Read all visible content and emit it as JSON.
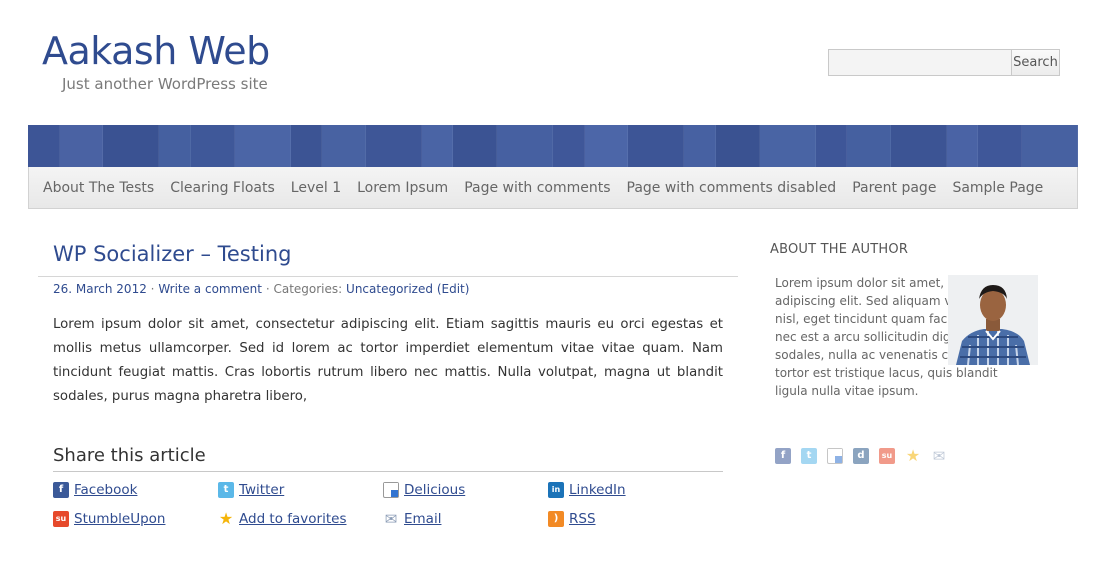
{
  "site": {
    "title": "Aakash Web",
    "tagline": "Just another WordPress site"
  },
  "search": {
    "placeholder": "",
    "button_label": "Search"
  },
  "nav": {
    "items": [
      {
        "label": "About The Tests"
      },
      {
        "label": "Clearing Floats"
      },
      {
        "label": "Level 1"
      },
      {
        "label": "Lorem Ipsum"
      },
      {
        "label": "Page with comments"
      },
      {
        "label": "Page with comments disabled"
      },
      {
        "label": "Parent page"
      },
      {
        "label": "Sample Page"
      }
    ]
  },
  "post": {
    "title": "WP Socializer – Testing",
    "date": "26. March 2012",
    "comment_link": "Write a comment",
    "categories_label": "Categories:",
    "category": "Uncategorized",
    "edit_link": "(Edit)",
    "body": "Lorem ipsum dolor sit amet, consectetur adipiscing elit. Etiam sagittis mauris eu orci egestas et mollis metus ullamcorper. Sed id lorem ac tortor imperdiet elementum vitae vitae quam. Nam tincidunt feugiat mattis. Cras lobortis rutrum libero nec mattis. Nulla volutpat, magna ut blandit sodales, purus magna pharetra libero,"
  },
  "share": {
    "heading": "Share this article",
    "items": [
      {
        "label": "Facebook",
        "icon": "facebook-icon",
        "color": "#3b5998"
      },
      {
        "label": "Twitter",
        "icon": "twitter-icon",
        "color": "#5bb8e8"
      },
      {
        "label": "Delicious",
        "icon": "delicious-icon",
        "color": "#222222"
      },
      {
        "label": "LinkedIn",
        "icon": "linkedin-icon",
        "color": "#1b73b8"
      },
      {
        "label": "StumbleUpon",
        "icon": "stumbleupon-icon",
        "color": "#e6492b"
      },
      {
        "label": "Add to favorites",
        "icon": "star-icon",
        "color": "#f5b50a"
      },
      {
        "label": "Email",
        "icon": "email-icon",
        "color": "#8a9bb5"
      },
      {
        "label": "RSS",
        "icon": "rss-icon",
        "color": "#f28a25"
      }
    ]
  },
  "sidebar": {
    "heading": "ABOUT THE AUTHOR",
    "author_text": "Lorem ipsum dolor sit amet, consectetur adipiscing elit. Sed aliquam venenatis nisl, eget tincidunt quam facilisis in. Sed nec est a arcu sollicitudin dignissim. Nulla sodales, nulla ac venenatis convallis, tortor est tristique lacus, quis blandit ligula nulla vitae ipsum.",
    "icons": [
      {
        "icon": "facebook-icon",
        "color": "#3b5998"
      },
      {
        "icon": "twitter-icon",
        "color": "#5bb8e8"
      },
      {
        "icon": "delicious-icon",
        "color": "#222222"
      },
      {
        "icon": "digg-icon",
        "color": "#2d5a8c"
      },
      {
        "icon": "stumbleupon-icon",
        "color": "#e6492b"
      },
      {
        "icon": "star-icon",
        "color": "#f5b50a"
      },
      {
        "icon": "email-icon",
        "color": "#8a9bb5"
      }
    ]
  },
  "colors": {
    "brand": "#2f4b8f",
    "banner": "#3f5798"
  }
}
